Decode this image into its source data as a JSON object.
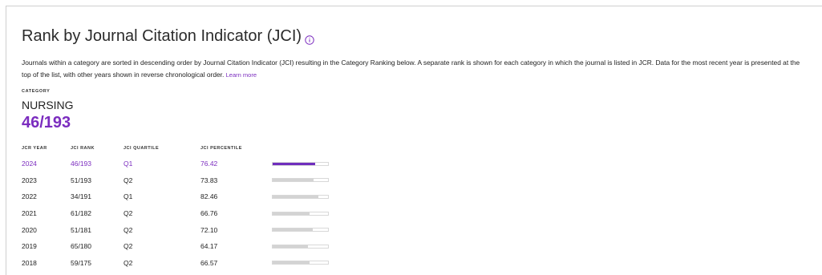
{
  "section": {
    "title": "Rank by Journal Citation Indicator (JCI)",
    "description": "Journals within a category are sorted in descending order by Journal Citation Indicator (JCI) resulting in the Category Ranking below. A separate rank is shown for each category in which the journal is listed in JCR. Data for the most recent year is presented at the top of the list, with other years shown in reverse chronological order.",
    "learn_more": "Learn more"
  },
  "category": {
    "label": "CATEGORY",
    "name": "NURSING",
    "rank": "46/193"
  },
  "table": {
    "headers": [
      "JCR YEAR",
      "JCI RANK",
      "JCI QUARTILE",
      "JCI PERCENTILE"
    ],
    "rows": [
      {
        "year": "2024",
        "rank": "46/193",
        "quartile": "Q1",
        "percentile": "76.42"
      },
      {
        "year": "2023",
        "rank": "51/193",
        "quartile": "Q2",
        "percentile": "73.83"
      },
      {
        "year": "2022",
        "rank": "34/191",
        "quartile": "Q1",
        "percentile": "82.46"
      },
      {
        "year": "2021",
        "rank": "61/182",
        "quartile": "Q2",
        "percentile": "66.76"
      },
      {
        "year": "2020",
        "rank": "51/181",
        "quartile": "Q2",
        "percentile": "72.10"
      },
      {
        "year": "2019",
        "rank": "65/180",
        "quartile": "Q2",
        "percentile": "64.17"
      },
      {
        "year": "2018",
        "rank": "59/175",
        "quartile": "Q2",
        "percentile": "66.57"
      }
    ]
  },
  "colors": {
    "accent": "#7b2cbf",
    "bar_active": "#6f2dbd",
    "bar_inactive": "#d3d3d3"
  }
}
